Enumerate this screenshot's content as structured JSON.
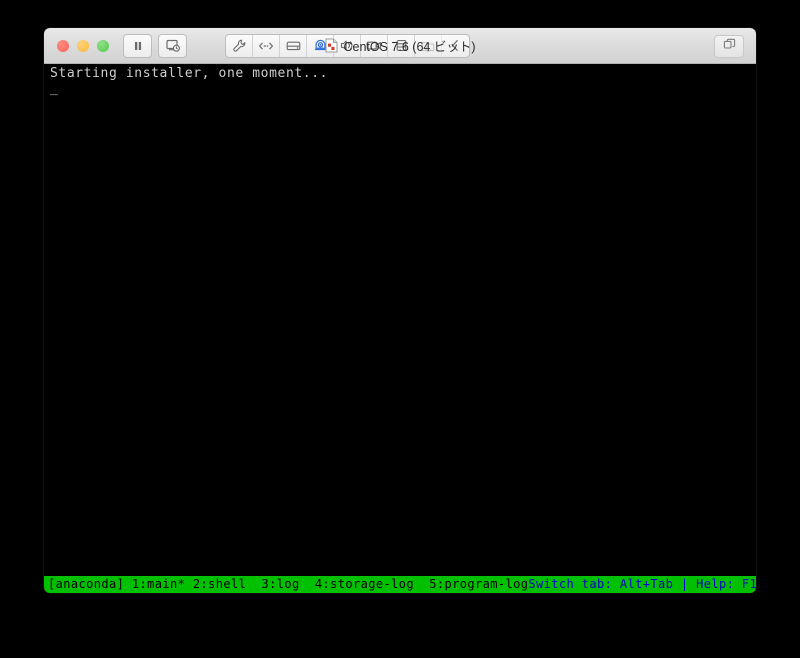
{
  "window": {
    "title": "CentOS 7.6 (64 ビット)",
    "title_icon": "vm-document-icon",
    "traffic_lights": [
      {
        "name": "close-button",
        "color": "#f4655b"
      },
      {
        "name": "minimize-button",
        "color": "#f6b73c"
      },
      {
        "name": "maximize-button",
        "color": "#4fc84a"
      }
    ],
    "toolbar": {
      "playback": [
        {
          "name": "pause-button",
          "icon": "pause-icon",
          "state": "enabled"
        },
        {
          "name": "snapshot-button",
          "icon": "snapshot-icon",
          "state": "enabled"
        }
      ],
      "devices": [
        {
          "name": "settings-button",
          "icon": "wrench-icon",
          "state": "enabled"
        },
        {
          "name": "network-button",
          "icon": "network-icon",
          "state": "enabled"
        },
        {
          "name": "hard-disk-button",
          "icon": "hard-disk-icon",
          "state": "enabled"
        },
        {
          "name": "camera-device-button",
          "icon": "webcam-icon",
          "state": "active"
        },
        {
          "name": "sound-button",
          "icon": "speaker-icon",
          "state": "enabled"
        },
        {
          "name": "video-camera-button",
          "icon": "video-camera-icon",
          "state": "enabled"
        },
        {
          "name": "printer-button",
          "icon": "printer-icon",
          "state": "enabled"
        },
        {
          "name": "shared-folder-button",
          "icon": "shared-folder-icon",
          "state": "disabled"
        },
        {
          "name": "collapse-toolbar-button",
          "icon": "chevron-left-icon",
          "state": "enabled"
        }
      ]
    },
    "unity_button": {
      "name": "unity-view-button",
      "icon": "window-restore-icon"
    }
  },
  "terminal": {
    "lines": [
      "Starting installer, one moment..."
    ],
    "cursor": "_",
    "foreground": "#cfcfcf",
    "background": "#000000"
  },
  "statusbar": {
    "background": "#00c000",
    "left_text": "[anaconda] 1:main* 2:shell  3:log  4:storage-log  5:program-log",
    "right_text": "Switch tab: Alt+Tab | Help: F1",
    "left_color": "#000000",
    "right_color": "#0000c8"
  }
}
